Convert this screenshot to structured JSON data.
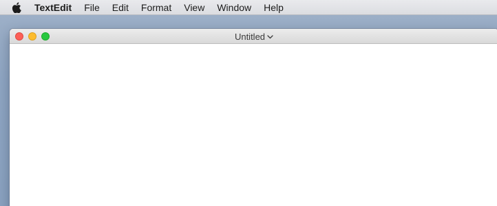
{
  "menubar": {
    "apple_icon": "apple-logo-icon",
    "app_name": "TextEdit",
    "items": [
      {
        "label": "File"
      },
      {
        "label": "Edit"
      },
      {
        "label": "Format"
      },
      {
        "label": "View"
      },
      {
        "label": "Window"
      },
      {
        "label": "Help"
      }
    ]
  },
  "window": {
    "title": "Untitled",
    "title_chevron_icon": "chevron-down-icon",
    "buttons": {
      "close_color": "#fc5f57",
      "minimize_color": "#fdbc2e",
      "zoom_color": "#28c840"
    },
    "document_text": ""
  }
}
